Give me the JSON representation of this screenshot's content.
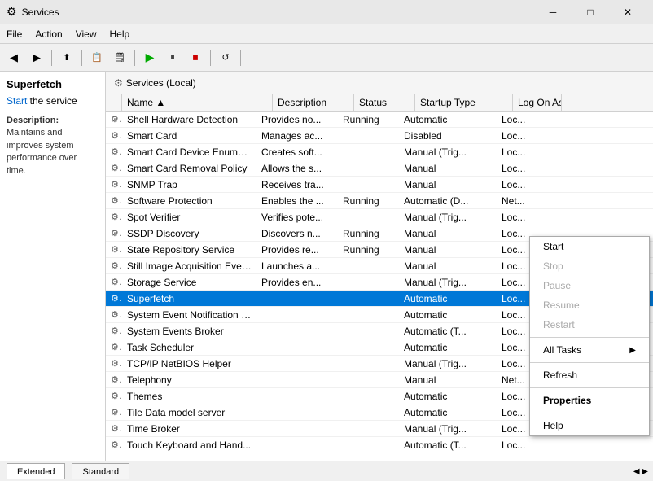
{
  "window": {
    "title": "Services",
    "icon": "⚙"
  },
  "titlebar": {
    "minimize": "─",
    "maximize": "□",
    "close": "✕"
  },
  "menu": {
    "items": [
      "File",
      "Action",
      "View",
      "Help"
    ]
  },
  "toolbar": {
    "buttons": [
      "◀",
      "▶",
      "📋",
      "🔲",
      "🖨",
      "⬤",
      "⭐",
      "▶",
      "⏸",
      "⏹",
      "⏭",
      "⏮"
    ]
  },
  "breadcrumb": {
    "root": "Services (Local)"
  },
  "leftPanel": {
    "header": "Superfetch",
    "start_label": "Start",
    "start_suffix": " the service",
    "desc_label": "Description:",
    "description": "Maintains and improves system performance over time."
  },
  "list": {
    "headers": [
      "Name",
      "Description",
      "Status",
      "Startup Type",
      "Log On As"
    ],
    "rows": [
      {
        "name": "Shell Hardware Detection",
        "desc": "Provides no...",
        "status": "Running",
        "startup": "Automatic",
        "log": "Loc..."
      },
      {
        "name": "Smart Card",
        "desc": "Manages ac...",
        "status": "",
        "startup": "Disabled",
        "log": "Loc..."
      },
      {
        "name": "Smart Card Device Enumera...",
        "desc": "Creates soft...",
        "status": "",
        "startup": "Manual (Trig...",
        "log": "Loc..."
      },
      {
        "name": "Smart Card Removal Policy",
        "desc": "Allows the s...",
        "status": "",
        "startup": "Manual",
        "log": "Loc..."
      },
      {
        "name": "SNMP Trap",
        "desc": "Receives tra...",
        "status": "",
        "startup": "Manual",
        "log": "Loc..."
      },
      {
        "name": "Software Protection",
        "desc": "Enables the ...",
        "status": "Running",
        "startup": "Automatic (D...",
        "log": "Net..."
      },
      {
        "name": "Spot Verifier",
        "desc": "Verifies pote...",
        "status": "",
        "startup": "Manual (Trig...",
        "log": "Loc..."
      },
      {
        "name": "SSDP Discovery",
        "desc": "Discovers n...",
        "status": "Running",
        "startup": "Manual",
        "log": "Loc..."
      },
      {
        "name": "State Repository Service",
        "desc": "Provides re...",
        "status": "Running",
        "startup": "Manual",
        "log": "Loc..."
      },
      {
        "name": "Still Image Acquisition Events",
        "desc": "Launches a...",
        "status": "",
        "startup": "Manual",
        "log": "Loc..."
      },
      {
        "name": "Storage Service",
        "desc": "Provides en...",
        "status": "",
        "startup": "Manual (Trig...",
        "log": "Loc..."
      },
      {
        "name": "Superfetch",
        "desc": "",
        "status": "",
        "startup": "Automatic",
        "log": "Loc...",
        "selected": true
      },
      {
        "name": "System Event Notification S...",
        "desc": "",
        "status": "",
        "startup": "Automatic",
        "log": "Loc..."
      },
      {
        "name": "System Events Broker",
        "desc": "",
        "status": "",
        "startup": "Automatic (T...",
        "log": "Loc..."
      },
      {
        "name": "Task Scheduler",
        "desc": "",
        "status": "",
        "startup": "Automatic",
        "log": "Loc..."
      },
      {
        "name": "TCP/IP NetBIOS Helper",
        "desc": "",
        "status": "",
        "startup": "Manual (Trig...",
        "log": "Loc..."
      },
      {
        "name": "Telephony",
        "desc": "",
        "status": "",
        "startup": "Manual",
        "log": "Net..."
      },
      {
        "name": "Themes",
        "desc": "",
        "status": "",
        "startup": "Automatic",
        "log": "Loc..."
      },
      {
        "name": "Tile Data model server",
        "desc": "",
        "status": "",
        "startup": "Automatic",
        "log": "Loc..."
      },
      {
        "name": "Time Broker",
        "desc": "",
        "status": "",
        "startup": "Manual (Trig...",
        "log": "Loc..."
      },
      {
        "name": "Touch Keyboard and Hand...",
        "desc": "",
        "status": "",
        "startup": "Automatic (T...",
        "log": "Loc..."
      }
    ]
  },
  "contextMenu": {
    "items": [
      {
        "label": "Start",
        "enabled": true,
        "bold": false,
        "submenu": false
      },
      {
        "label": "Stop",
        "enabled": false,
        "bold": false,
        "submenu": false
      },
      {
        "label": "Pause",
        "enabled": false,
        "bold": false,
        "submenu": false
      },
      {
        "label": "Resume",
        "enabled": false,
        "bold": false,
        "submenu": false
      },
      {
        "label": "Restart",
        "enabled": false,
        "bold": false,
        "submenu": false
      },
      {
        "sep": true
      },
      {
        "label": "All Tasks",
        "enabled": true,
        "bold": false,
        "submenu": true
      },
      {
        "sep": true
      },
      {
        "label": "Refresh",
        "enabled": true,
        "bold": false,
        "submenu": false
      },
      {
        "sep": true
      },
      {
        "label": "Properties",
        "enabled": true,
        "bold": true,
        "submenu": false
      },
      {
        "sep": true
      },
      {
        "label": "Help",
        "enabled": true,
        "bold": false,
        "submenu": false
      }
    ]
  },
  "statusBar": {
    "tabs": [
      "Extended",
      "Standard"
    ]
  }
}
